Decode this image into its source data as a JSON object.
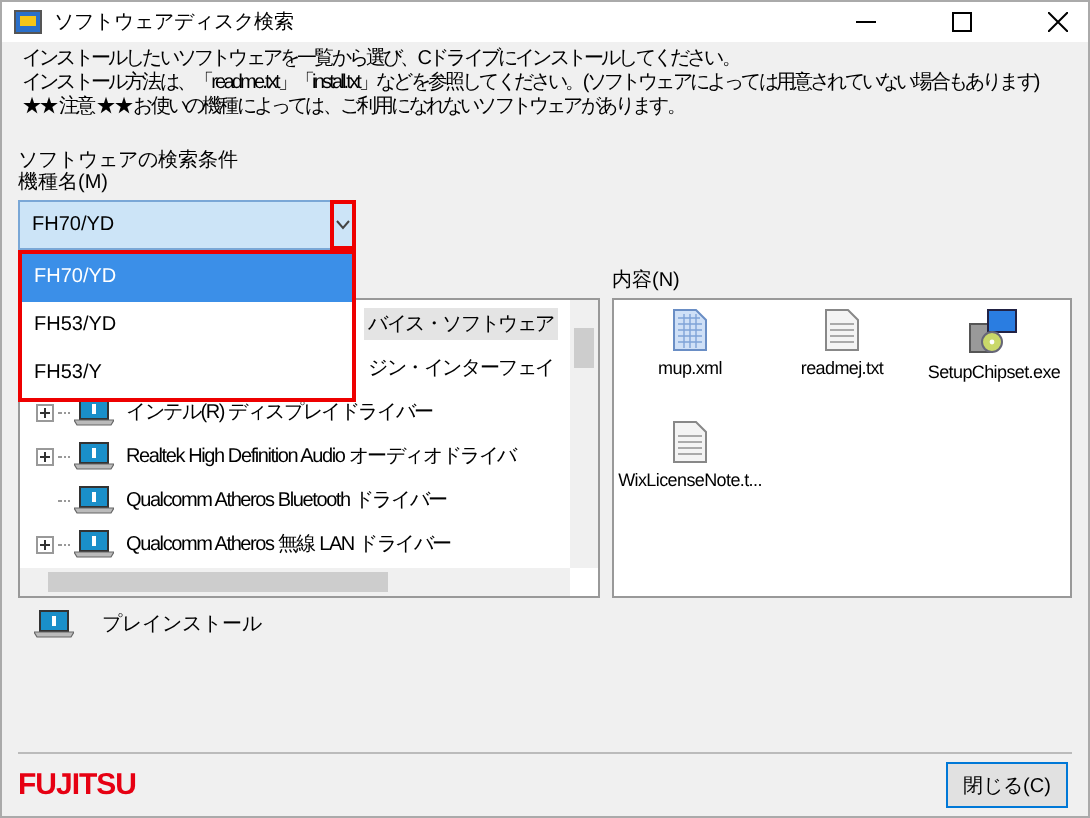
{
  "window": {
    "title": "ソフトウェアディスク検索"
  },
  "instructions": [
    "インストールしたいソフトウェアを一覧から選び、Cドライブにインストールしてください。",
    "インストール方法は、「readme.txt」「install.txt」などを参照してください。(ソフトウェアによっては用意されていない場合もあります)",
    "★★ 注意 ★★ お使いの機種によっては、ご利用になれないソフトウェアがあります。"
  ],
  "search_label": "ソフトウェアの検索条件",
  "model_label": "機種名(M)",
  "model_combo": {
    "value": "FH70/YD",
    "expanded": true,
    "options": [
      {
        "label": "FH70/YD",
        "selected": true
      },
      {
        "label": "FH53/YD",
        "selected": false
      },
      {
        "label": "FH53/Y",
        "selected": false
      }
    ]
  },
  "tree": {
    "items": [
      {
        "kind": "cut",
        "label": "バイス・ソフトウェア",
        "selected": true
      },
      {
        "kind": "cut",
        "label": "ジン・インターフェイ",
        "selected": false
      },
      {
        "kind": "item",
        "label": "インテル(R) ディスプレイドライバー",
        "selected": false,
        "expandable": true
      },
      {
        "kind": "item",
        "label": "Realtek High Definition Audio オーディオドライバ",
        "selected": false,
        "expandable": true
      },
      {
        "kind": "item",
        "label": "Qualcomm Atheros Bluetooth ドライバー",
        "selected": false,
        "expandable": false
      },
      {
        "kind": "item",
        "label": "Qualcomm Atheros 無線 LAN ドライバー",
        "selected": false,
        "expandable": true
      }
    ]
  },
  "contents": {
    "label": "内容(N)",
    "files": [
      {
        "kind": "xml",
        "name": "mup.xml"
      },
      {
        "kind": "text",
        "name": "readmej.txt"
      },
      {
        "kind": "installer",
        "name": "SetupChipset.exe"
      },
      {
        "kind": "text",
        "name": "WixLicenseNote.t..."
      }
    ]
  },
  "install_button": "プレインストール",
  "logo": "FUJITSU",
  "close_button": "閉じる(C)"
}
